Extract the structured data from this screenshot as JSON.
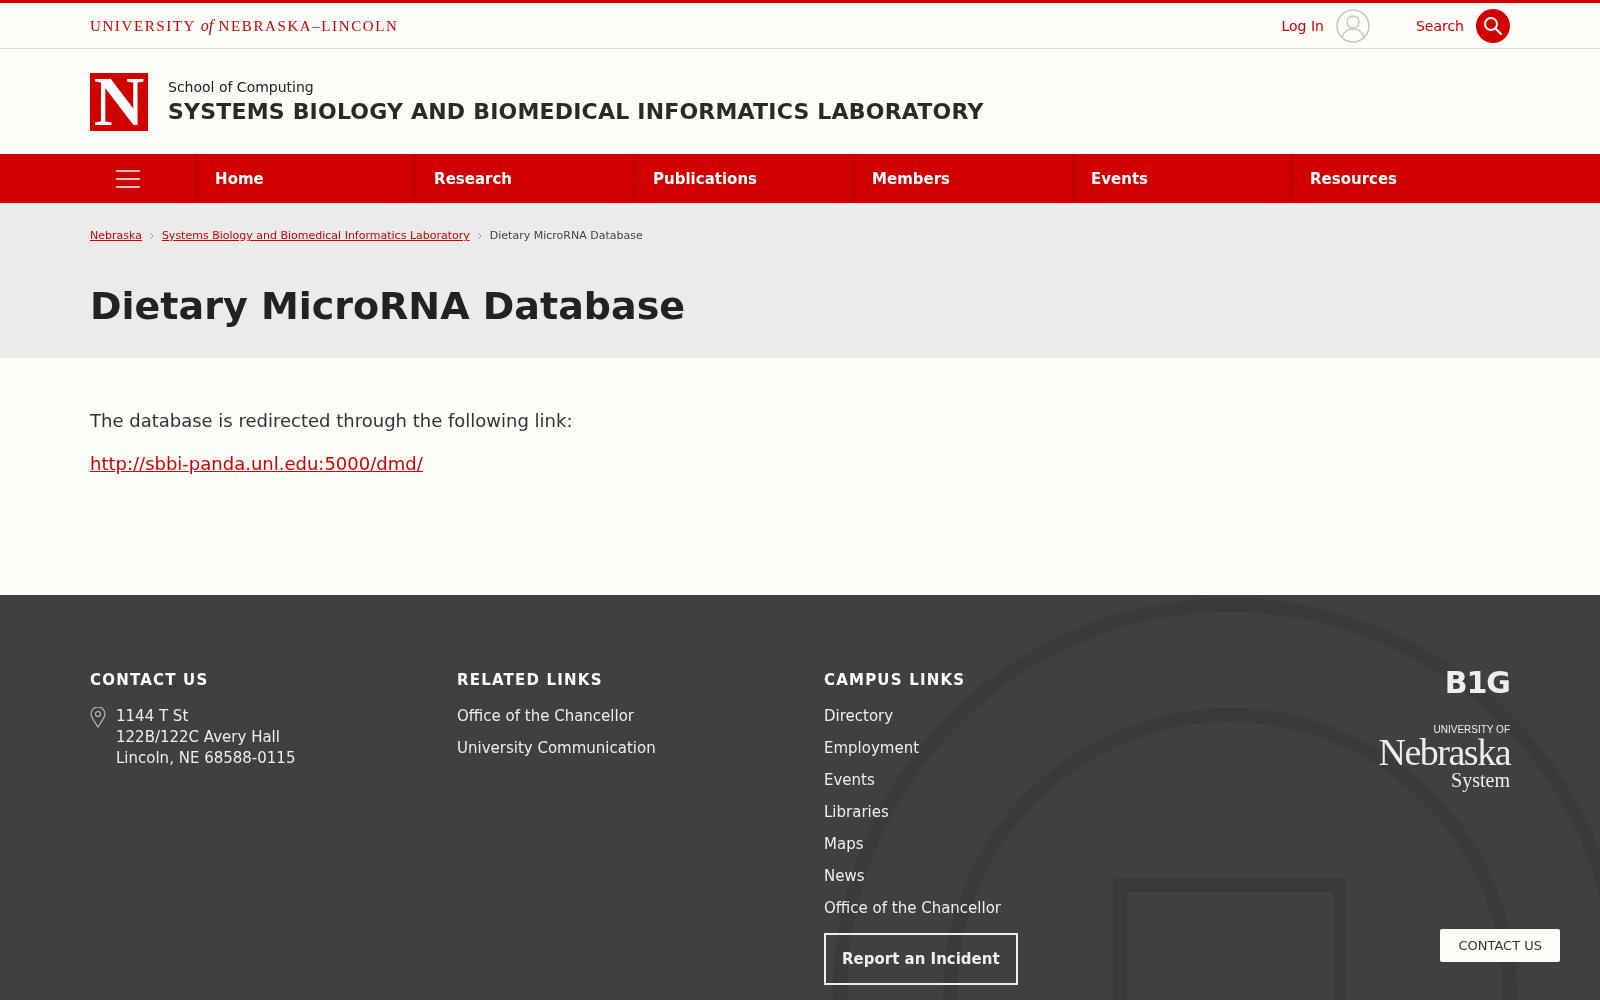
{
  "top_bar": {
    "wordmark": {
      "before": "UNIVERSITY",
      "italic": "of",
      "after": "NEBRASKA–LINCOLN"
    },
    "login": "Log In",
    "search": "Search"
  },
  "site_header": {
    "logo_letter": "N",
    "parent_unit": "School of Computing",
    "site_title": "SYSTEMS BIOLOGY AND BIOMEDICAL INFORMATICS LABORATORY"
  },
  "nav": {
    "items": [
      {
        "label": "Home"
      },
      {
        "label": "Research"
      },
      {
        "label": "Publications"
      },
      {
        "label": "Members"
      },
      {
        "label": "Events"
      },
      {
        "label": "Resources"
      }
    ]
  },
  "breadcrumbs": [
    {
      "label": "Nebraska",
      "link": true
    },
    {
      "label": "Systems Biology and Biomedical Informatics Laboratory",
      "link": true
    },
    {
      "label": "Dietary MicroRNA Database",
      "link": false
    }
  ],
  "page_title": "Dietary MicroRNA Database",
  "content": {
    "paragraph": "The database is redirected through the following link:",
    "link": "http://sbbi-panda.unl.edu:5000/dmd/"
  },
  "footer": {
    "contact": {
      "heading": "CONTACT US",
      "lines": [
        "1144 T St",
        "122B/122C Avery Hall",
        "Lincoln, NE 68588-0115"
      ]
    },
    "related": {
      "heading": "RELATED LINKS",
      "links": [
        "Office of the Chancellor",
        "University Communication"
      ]
    },
    "campus": {
      "heading": "CAMPUS LINKS",
      "links": [
        "Directory",
        "Employment",
        "Events",
        "Libraries",
        "Maps",
        "News",
        "Office of the Chancellor"
      ],
      "button": "Report an Incident"
    },
    "big_logo": "B1G",
    "system_logo": {
      "top": "UNIVERSITY OF",
      "main": "Nebraska",
      "bottom": "System"
    },
    "contact_tab": "CONTACT US"
  }
}
